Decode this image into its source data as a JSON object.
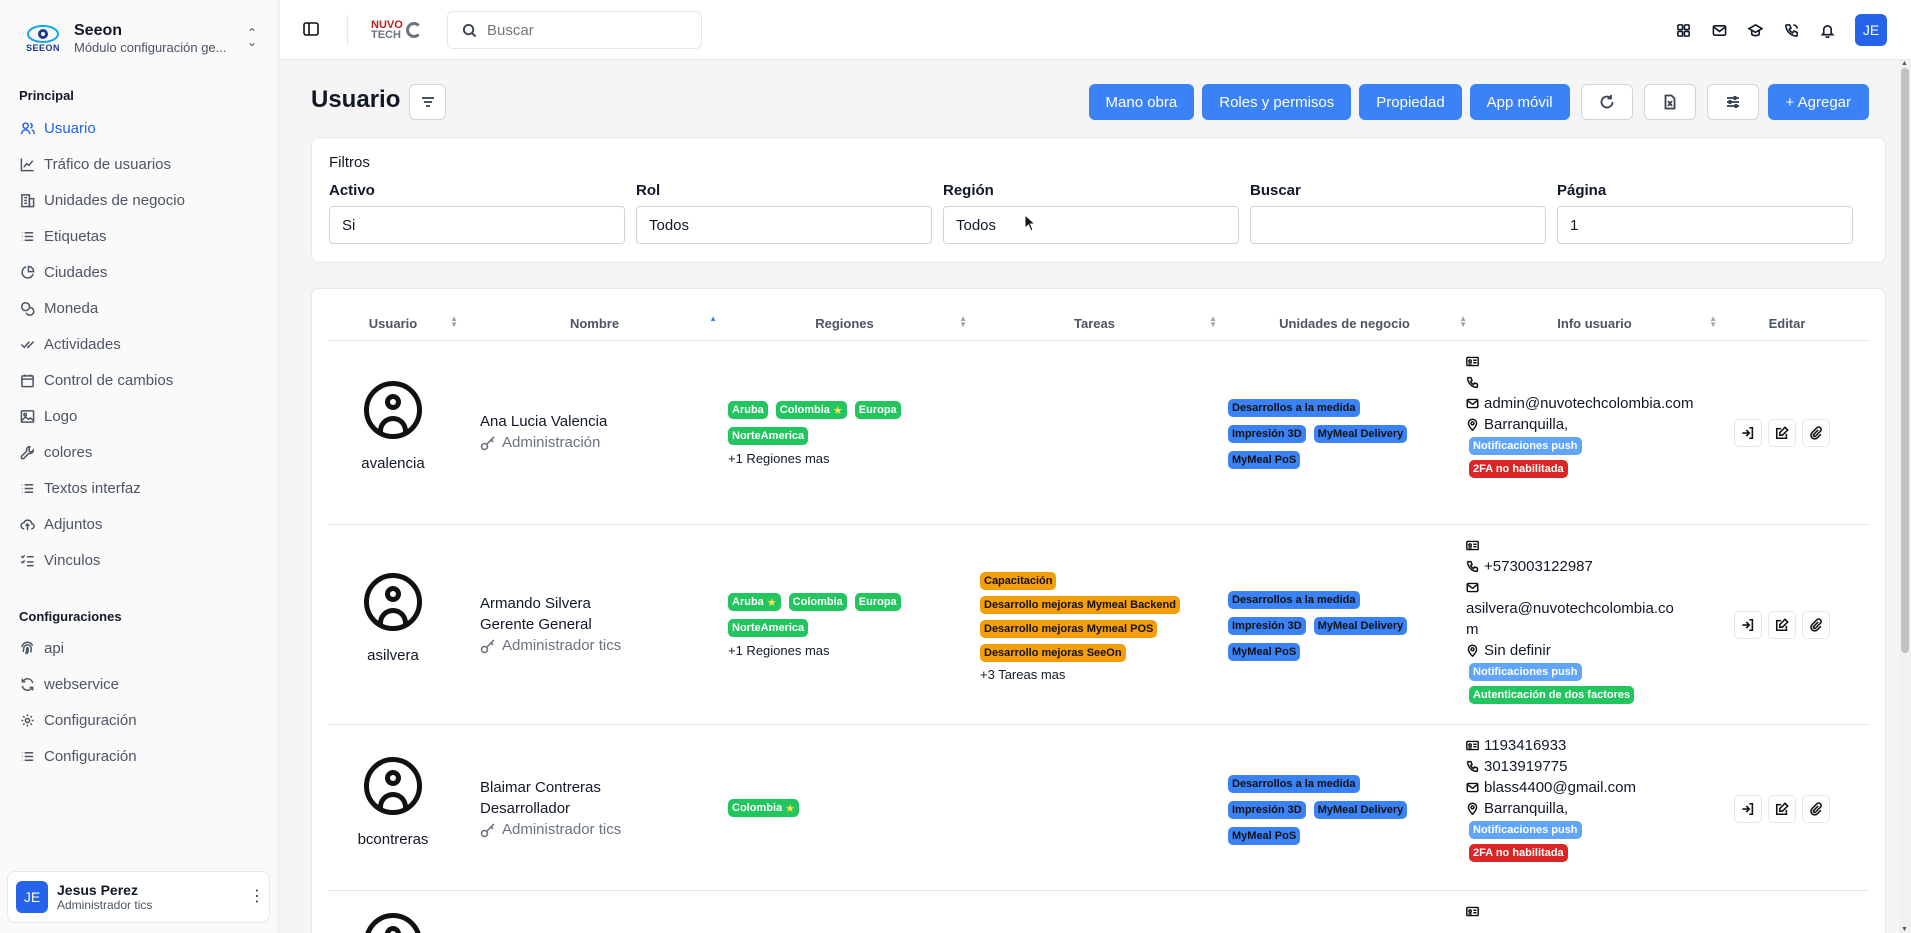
{
  "brand": {
    "name": "Seeon",
    "subtitle": "Módulo configuración ge...",
    "logo_text": "SEEON"
  },
  "sidebar": {
    "section_principal": "Principal",
    "items": [
      {
        "label": "Usuario",
        "icon": "users-icon",
        "active": true
      },
      {
        "label": "Tráfico de usuarios",
        "icon": "chart-line-icon"
      },
      {
        "label": "Unidades de negocio",
        "icon": "building-icon"
      },
      {
        "label": "Etiquetas",
        "icon": "list-icon"
      },
      {
        "label": "Ciudades",
        "icon": "pie-chart-icon"
      },
      {
        "label": "Moneda",
        "icon": "coins-icon"
      },
      {
        "label": "Actividades",
        "icon": "check-double-icon"
      },
      {
        "label": "Control de cambios",
        "icon": "calendar-icon"
      },
      {
        "label": "Logo",
        "icon": "image-icon"
      },
      {
        "label": "colores",
        "icon": "wrench-icon"
      },
      {
        "label": "Textos interfaz",
        "icon": "list-icon"
      },
      {
        "label": "Adjuntos",
        "icon": "cloud-upload-icon"
      },
      {
        "label": "Vinculos",
        "icon": "list-checks-icon"
      }
    ],
    "section_config": "Configuraciones",
    "config_items": [
      {
        "label": "api",
        "icon": "fingerprint-icon"
      },
      {
        "label": "webservice",
        "icon": "refresh-icon"
      },
      {
        "label": "Configuración",
        "icon": "settings-icon"
      },
      {
        "label": "Configuración",
        "icon": "list-icon"
      }
    ],
    "user": {
      "initials": "JE",
      "name": "Jesus Perez",
      "role": "Administrador tics"
    }
  },
  "topbar": {
    "search_placeholder": "Buscar",
    "logo_text_1": "NUVO",
    "logo_text_2": "TECH",
    "avatar": "JE"
  },
  "page": {
    "title": "Usuario",
    "actions": [
      "Mano obra",
      "Roles y permisos",
      "Propiedad",
      "App móvil"
    ],
    "add_label": "+ Agregar"
  },
  "filters": {
    "title": "Filtros",
    "fields": [
      {
        "label": "Activo",
        "value": "Si"
      },
      {
        "label": "Rol",
        "value": "Todos"
      },
      {
        "label": "Región",
        "value": "Todos"
      },
      {
        "label": "Buscar",
        "value": ""
      },
      {
        "label": "Página",
        "value": "1"
      }
    ]
  },
  "table": {
    "columns": [
      "Usuario",
      "Nombre",
      "Regiones",
      "Tareas",
      "Unidades de negocio",
      "Info usuario",
      "Editar"
    ],
    "rows": [
      {
        "username": "avalencia",
        "name": "Ana Lucia Valencia",
        "title": "",
        "role": "Administración",
        "regions": [
          {
            "t": "Aruba"
          },
          {
            "t": "Colombia",
            "star": true
          },
          {
            "t": "Europa"
          },
          {
            "t": "NorteAmerica"
          }
        ],
        "regions_more": "+1 Regiones mas",
        "tasks": [],
        "tasks_more": "",
        "units": [
          "Desarrollos a la medida",
          "Impresión 3D",
          "MyMeal Delivery",
          "MyMeal PoS"
        ],
        "id_doc": "",
        "phone": "",
        "email": "admin@nuvotechcolombia.com",
        "city": "Barranquilla,",
        "badges": [
          {
            "t": "Notificaciones push",
            "c": "lightblue"
          },
          {
            "t": "2FA no habilitada",
            "c": "red"
          }
        ]
      },
      {
        "username": "asilvera",
        "name": "Armando Silvera",
        "title": "Gerente General",
        "role": "Administrador tics",
        "regions": [
          {
            "t": "Aruba",
            "star": true
          },
          {
            "t": "Colombia"
          },
          {
            "t": "Europa"
          },
          {
            "t": "NorteAmerica"
          }
        ],
        "regions_more": "+1 Regiones mas",
        "tasks": [
          "Capacitación",
          "Desarrollo mejoras Mymeal Backend",
          "Desarrollo mejoras Mymeal POS",
          "Desarrollo mejoras SeeOn"
        ],
        "tasks_more": "+3 Tareas mas",
        "units": [
          "Desarrollos a la medida",
          "Impresión 3D",
          "MyMeal Delivery",
          "MyMeal PoS"
        ],
        "id_doc": "",
        "phone": "+573003122987",
        "email": "asilvera@nuvotechcolombia.com",
        "city": "Sin definir",
        "badges": [
          {
            "t": "Notificaciones push",
            "c": "lightblue"
          },
          {
            "t": "Autenticación de dos factores",
            "c": "green"
          }
        ]
      },
      {
        "username": "bcontreras",
        "name": "Blaimar Contreras",
        "title": "Desarrollador",
        "role": "Administrador tics",
        "regions": [
          {
            "t": "Colombia",
            "star": true
          }
        ],
        "regions_more": "",
        "tasks": [],
        "tasks_more": "",
        "units": [
          "Desarrollos a la medida",
          "Impresión 3D",
          "MyMeal Delivery",
          "MyMeal PoS"
        ],
        "id_doc": "1193416933",
        "phone": "3013919775",
        "email": "blass4400@gmail.com",
        "city": "Barranquilla,",
        "badges": [
          {
            "t": "Notificaciones push",
            "c": "lightblue"
          },
          {
            "t": "2FA no habilitada",
            "c": "red"
          }
        ]
      }
    ]
  },
  "colors": {
    "accent": "#3b82f6",
    "active_nav": "#2563eb",
    "tag_region": "#22c55e",
    "tag_task": "#f59e0b",
    "tag_unit": "#3b82f6",
    "badge_red": "#dc2626"
  }
}
